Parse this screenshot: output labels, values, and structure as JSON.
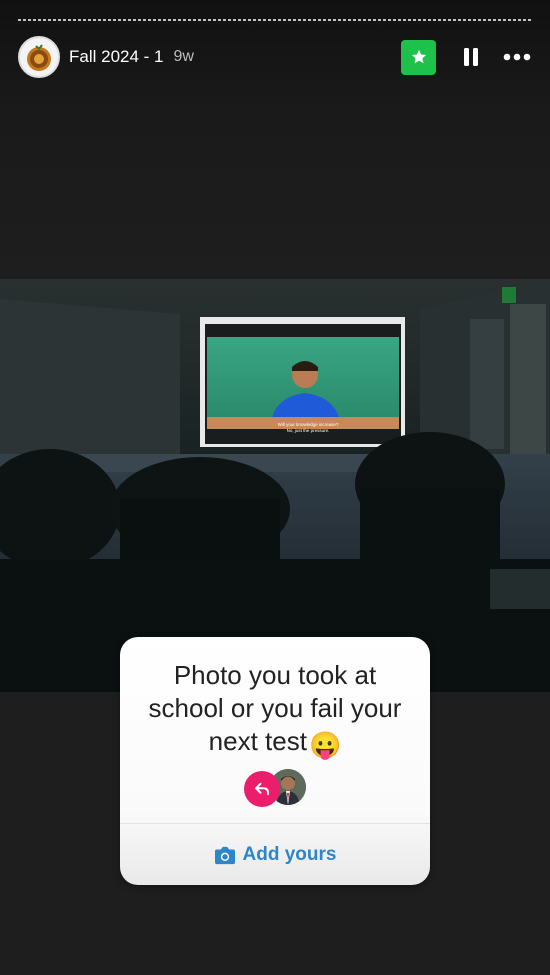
{
  "header": {
    "title": "Fall 2024 - 1",
    "age": "9w"
  },
  "photo": {
    "screen_subtitle_line1": "Will your knowledge increase?",
    "screen_subtitle_line2": "No, just the pressure.",
    "exit_sign": "EXIT"
  },
  "sticker": {
    "prompt": "Photo you took at school or you fail your next test",
    "emoji": "😛",
    "add_yours_label": "Add yours"
  },
  "colors": {
    "favorite_green": "#1ec24a",
    "reply_pink": "#ec1d6a",
    "add_yours_blue": "#2d86c9"
  }
}
